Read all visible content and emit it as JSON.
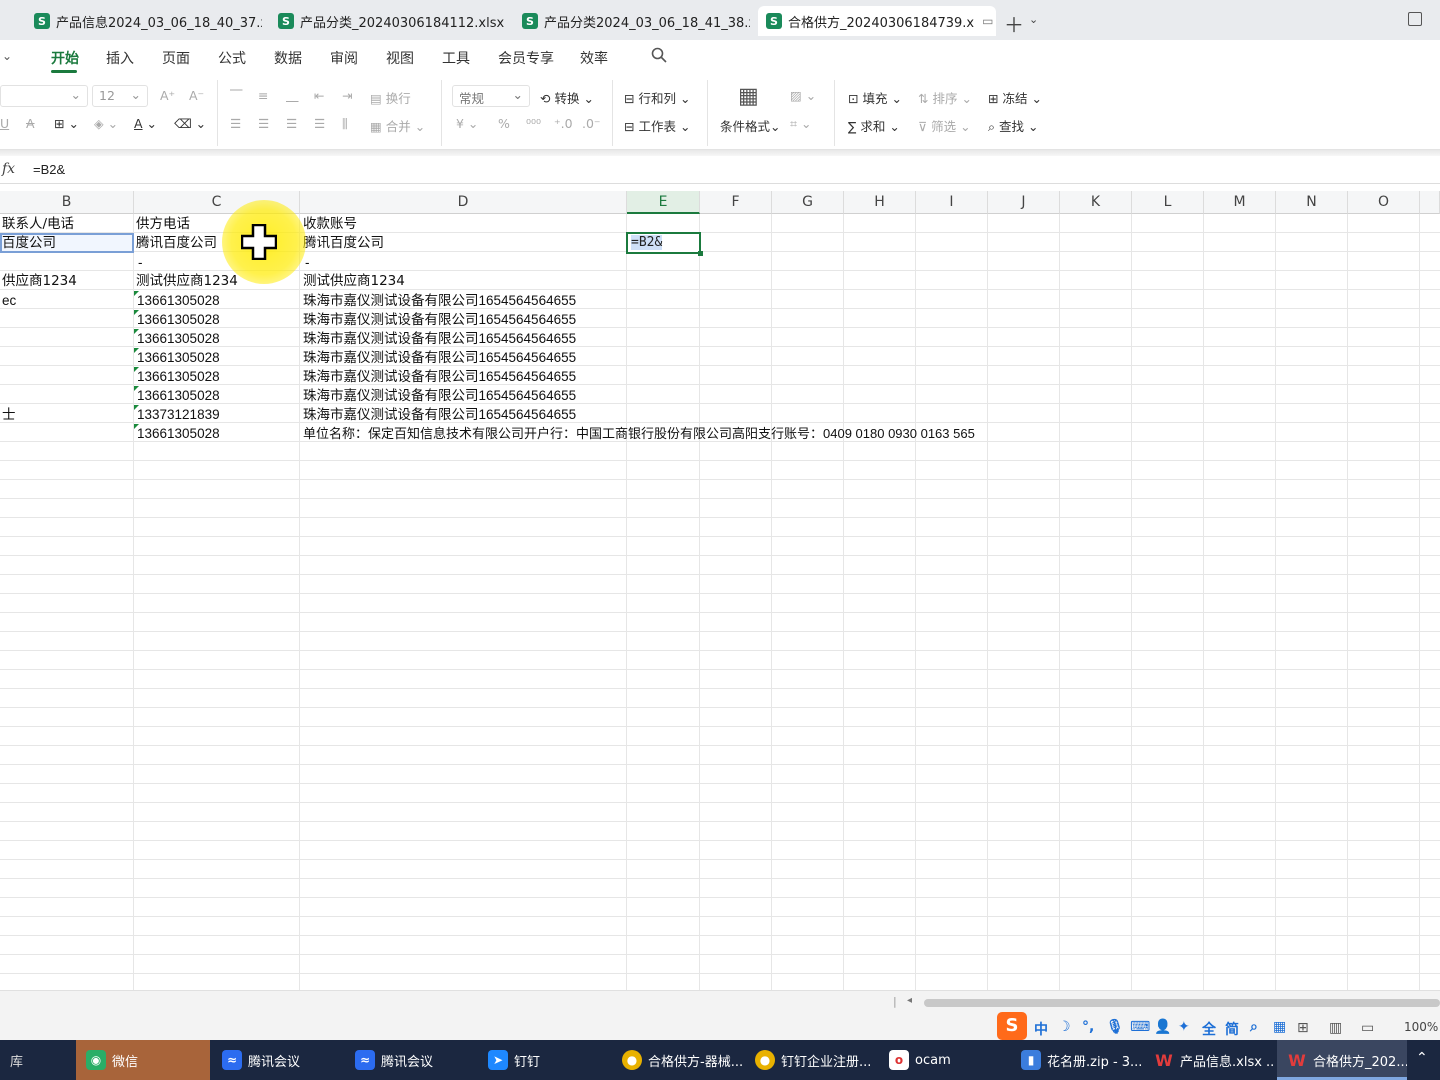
{
  "tabs": [
    {
      "label": "产品信息2024_03_06_18_40_37.xlsx",
      "active": false
    },
    {
      "label": "产品分类_20240306184112.xlsx",
      "active": false
    },
    {
      "label": "产品分类2024_03_06_18_41_38.xlsx",
      "active": false
    },
    {
      "label": "合格供方_20240306184739.x",
      "active": true
    }
  ],
  "menu": [
    "开始",
    "插入",
    "页面",
    "公式",
    "数据",
    "审阅",
    "视图",
    "工具",
    "会员专享",
    "效率"
  ],
  "ribbon": {
    "font_size": "12",
    "wrap": "换行",
    "merge": "合并",
    "number_format": "常规",
    "convert": "转换",
    "row_col": "行和列",
    "worksheet": "工作表",
    "cond_format": "条件格式",
    "fill": "填充",
    "sort": "排序",
    "freeze": "冻结",
    "sum": "求和",
    "filter": "筛选",
    "find": "查找"
  },
  "formula": {
    "fx": "fx",
    "text": "=B2&"
  },
  "columns": [
    "B",
    "C",
    "D",
    "E",
    "F",
    "G",
    "H",
    "I",
    "J",
    "K",
    "L",
    "M",
    "N",
    "O"
  ],
  "active_column": "E",
  "cells": {
    "header": {
      "b": "联系人/电话",
      "c": "供方电话",
      "d": "收款账号"
    },
    "row2": {
      "b": "百度公司",
      "c": "腾讯百度公司",
      "d": "腾讯百度公司",
      "e": "=B2&"
    },
    "row3": {
      "c": "-",
      "d": "-"
    },
    "row4": {
      "b": "供应商1234",
      "c": "测试供应商1234",
      "d": "测试供应商1234"
    },
    "rows": [
      {
        "b": "ec",
        "c": "13661305028",
        "d": "珠海市嘉仪测试设备有限公司1654564564655"
      },
      {
        "b": "",
        "c": "13661305028",
        "d": "珠海市嘉仪测试设备有限公司1654564564655"
      },
      {
        "b": "",
        "c": "13661305028",
        "d": "珠海市嘉仪测试设备有限公司1654564564655"
      },
      {
        "b": "",
        "c": "13661305028",
        "d": "珠海市嘉仪测试设备有限公司1654564564655"
      },
      {
        "b": "",
        "c": "13661305028",
        "d": "珠海市嘉仪测试设备有限公司1654564564655"
      },
      {
        "b": "",
        "c": "13661305028",
        "d": "珠海市嘉仪测试设备有限公司1654564564655"
      },
      {
        "b": "士",
        "c": "13373121839",
        "d": "珠海市嘉仪测试设备有限公司1654564564655"
      },
      {
        "b": "",
        "c": "13661305028",
        "d": "单位名称：保定百知信息技术有限公司开户行：中国工商银行股份有限公司高阳支行账号：0409 0180 0930 0163 565"
      }
    ]
  },
  "status": {
    "zoom": "100%",
    "ime": [
      "中",
      "简",
      "全"
    ]
  },
  "taskbar": [
    {
      "label": "微信"
    },
    {
      "label": "腾讯会议"
    },
    {
      "label": "腾讯会议"
    },
    {
      "label": "钉钉"
    },
    {
      "label": "合格供方-器械..."
    },
    {
      "label": "钉钉企业注册..."
    },
    {
      "label": "ocam"
    },
    {
      "label": "花名册.zip - 3..."
    },
    {
      "label": "产品信息.xlsx ..."
    },
    {
      "label": "合格供方_202..."
    }
  ],
  "colors": {
    "accent": "#1b7a3e",
    "taskbar": "#1b2740"
  }
}
